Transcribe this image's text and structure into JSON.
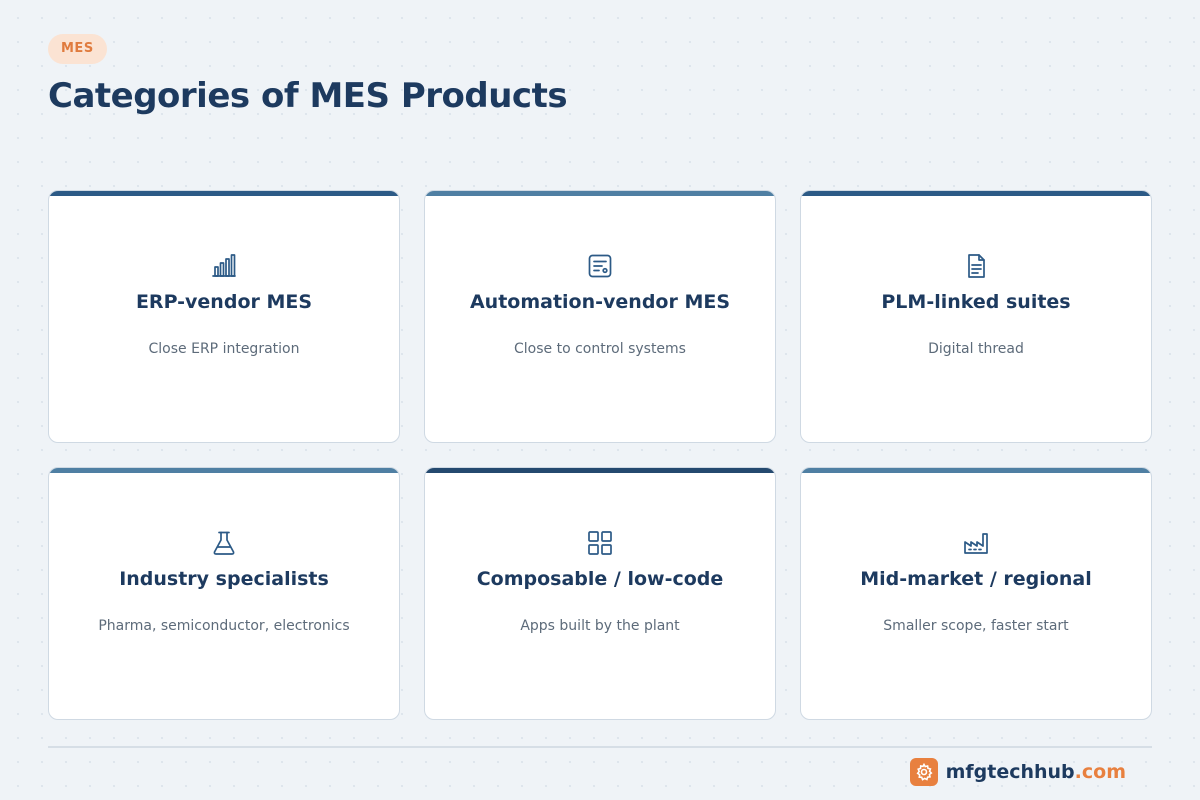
{
  "header": {
    "tag": "MES",
    "title": "Categories of MES Products"
  },
  "cards": [
    {
      "title": "ERP-vendor MES",
      "description": "Close ERP integration",
      "icon": "bar-chart-icon",
      "accent": "#2c5a86"
    },
    {
      "title": "Automation-vendor MES",
      "description": "Close to control systems",
      "icon": "list-card-icon",
      "accent": "#4f7fa3"
    },
    {
      "title": "PLM-linked suites",
      "description": "Digital thread",
      "icon": "document-icon",
      "accent": "#2c5a86"
    },
    {
      "title": "Industry specialists",
      "description": "Pharma, semiconductor, electronics",
      "icon": "flask-icon",
      "accent": "#4f7fa3"
    },
    {
      "title": "Composable / low-code",
      "description": "Apps built by the plant",
      "icon": "grid-icon",
      "accent": "#24496f"
    },
    {
      "title": "Mid-market / regional",
      "description": "Smaller scope, faster start",
      "icon": "factory-icon",
      "accent": "#4f7fa3"
    }
  ],
  "footer": {
    "brand_name": "mfgtechhub",
    "brand_tld": ".com",
    "logo_icon": "gear-icon",
    "brand_color": "#e8803f"
  }
}
